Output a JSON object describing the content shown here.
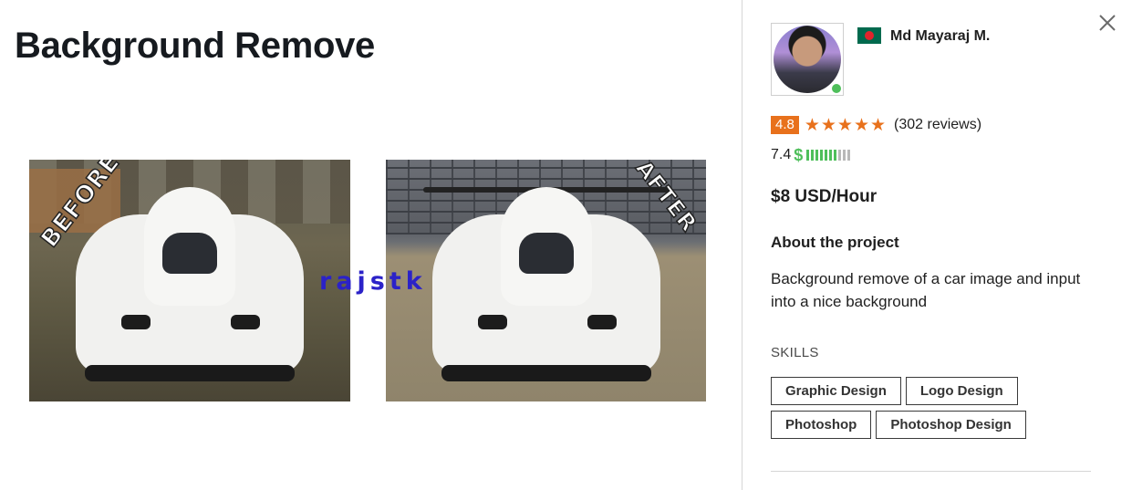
{
  "project": {
    "title": "Background Remove",
    "before_label": "BEFORE",
    "after_label": "AFTER",
    "watermark": "rajstk"
  },
  "freelancer": {
    "name": "Md Mayaraj M.",
    "country_flag_icon": "bangladesh-flag-icon",
    "online": true,
    "rating": "4.8",
    "stars": 5,
    "reviews": "(302 reviews)",
    "earnings_score": "7.4",
    "earnings_level": 0.7,
    "rate": "$8 USD/Hour"
  },
  "about": {
    "heading": "About the project",
    "text": "Background remove of a car image and input into a nice background"
  },
  "skills": {
    "heading": "SKILLS",
    "items": [
      "Graphic Design",
      "Logo Design",
      "Photoshop",
      "Photoshop Design"
    ]
  },
  "colors": {
    "accent_orange": "#e8711c",
    "online_green": "#4fbf5b",
    "watermark_blue": "#2b22c8"
  }
}
